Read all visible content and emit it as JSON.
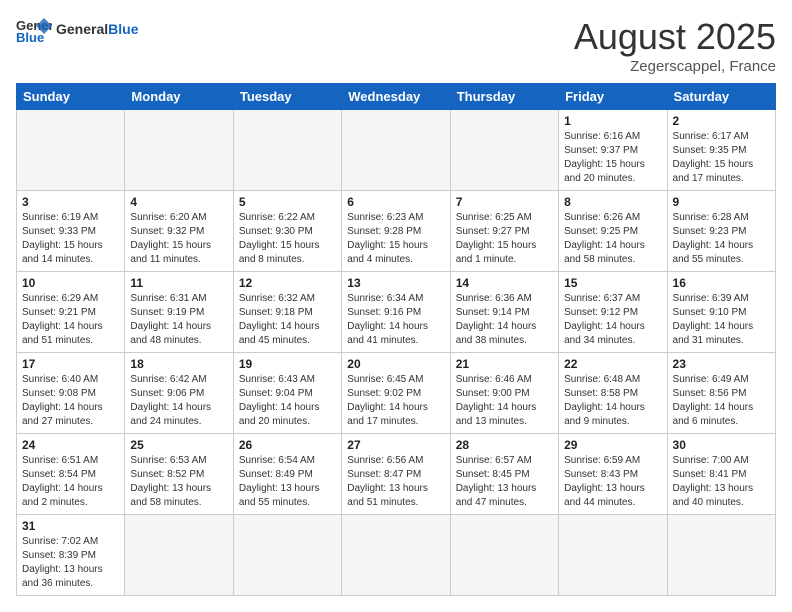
{
  "header": {
    "logo_general": "General",
    "logo_blue": "Blue",
    "month_year": "August 2025",
    "location": "Zegerscappel, France"
  },
  "weekdays": [
    "Sunday",
    "Monday",
    "Tuesday",
    "Wednesday",
    "Thursday",
    "Friday",
    "Saturday"
  ],
  "weeks": [
    [
      {
        "day": "",
        "info": ""
      },
      {
        "day": "",
        "info": ""
      },
      {
        "day": "",
        "info": ""
      },
      {
        "day": "",
        "info": ""
      },
      {
        "day": "",
        "info": ""
      },
      {
        "day": "1",
        "info": "Sunrise: 6:16 AM\nSunset: 9:37 PM\nDaylight: 15 hours\nand 20 minutes."
      },
      {
        "day": "2",
        "info": "Sunrise: 6:17 AM\nSunset: 9:35 PM\nDaylight: 15 hours\nand 17 minutes."
      }
    ],
    [
      {
        "day": "3",
        "info": "Sunrise: 6:19 AM\nSunset: 9:33 PM\nDaylight: 15 hours\nand 14 minutes."
      },
      {
        "day": "4",
        "info": "Sunrise: 6:20 AM\nSunset: 9:32 PM\nDaylight: 15 hours\nand 11 minutes."
      },
      {
        "day": "5",
        "info": "Sunrise: 6:22 AM\nSunset: 9:30 PM\nDaylight: 15 hours\nand 8 minutes."
      },
      {
        "day": "6",
        "info": "Sunrise: 6:23 AM\nSunset: 9:28 PM\nDaylight: 15 hours\nand 4 minutes."
      },
      {
        "day": "7",
        "info": "Sunrise: 6:25 AM\nSunset: 9:27 PM\nDaylight: 15 hours\nand 1 minute."
      },
      {
        "day": "8",
        "info": "Sunrise: 6:26 AM\nSunset: 9:25 PM\nDaylight: 14 hours\nand 58 minutes."
      },
      {
        "day": "9",
        "info": "Sunrise: 6:28 AM\nSunset: 9:23 PM\nDaylight: 14 hours\nand 55 minutes."
      }
    ],
    [
      {
        "day": "10",
        "info": "Sunrise: 6:29 AM\nSunset: 9:21 PM\nDaylight: 14 hours\nand 51 minutes."
      },
      {
        "day": "11",
        "info": "Sunrise: 6:31 AM\nSunset: 9:19 PM\nDaylight: 14 hours\nand 48 minutes."
      },
      {
        "day": "12",
        "info": "Sunrise: 6:32 AM\nSunset: 9:18 PM\nDaylight: 14 hours\nand 45 minutes."
      },
      {
        "day": "13",
        "info": "Sunrise: 6:34 AM\nSunset: 9:16 PM\nDaylight: 14 hours\nand 41 minutes."
      },
      {
        "day": "14",
        "info": "Sunrise: 6:36 AM\nSunset: 9:14 PM\nDaylight: 14 hours\nand 38 minutes."
      },
      {
        "day": "15",
        "info": "Sunrise: 6:37 AM\nSunset: 9:12 PM\nDaylight: 14 hours\nand 34 minutes."
      },
      {
        "day": "16",
        "info": "Sunrise: 6:39 AM\nSunset: 9:10 PM\nDaylight: 14 hours\nand 31 minutes."
      }
    ],
    [
      {
        "day": "17",
        "info": "Sunrise: 6:40 AM\nSunset: 9:08 PM\nDaylight: 14 hours\nand 27 minutes."
      },
      {
        "day": "18",
        "info": "Sunrise: 6:42 AM\nSunset: 9:06 PM\nDaylight: 14 hours\nand 24 minutes."
      },
      {
        "day": "19",
        "info": "Sunrise: 6:43 AM\nSunset: 9:04 PM\nDaylight: 14 hours\nand 20 minutes."
      },
      {
        "day": "20",
        "info": "Sunrise: 6:45 AM\nSunset: 9:02 PM\nDaylight: 14 hours\nand 17 minutes."
      },
      {
        "day": "21",
        "info": "Sunrise: 6:46 AM\nSunset: 9:00 PM\nDaylight: 14 hours\nand 13 minutes."
      },
      {
        "day": "22",
        "info": "Sunrise: 6:48 AM\nSunset: 8:58 PM\nDaylight: 14 hours\nand 9 minutes."
      },
      {
        "day": "23",
        "info": "Sunrise: 6:49 AM\nSunset: 8:56 PM\nDaylight: 14 hours\nand 6 minutes."
      }
    ],
    [
      {
        "day": "24",
        "info": "Sunrise: 6:51 AM\nSunset: 8:54 PM\nDaylight: 14 hours\nand 2 minutes."
      },
      {
        "day": "25",
        "info": "Sunrise: 6:53 AM\nSunset: 8:52 PM\nDaylight: 13 hours\nand 58 minutes."
      },
      {
        "day": "26",
        "info": "Sunrise: 6:54 AM\nSunset: 8:49 PM\nDaylight: 13 hours\nand 55 minutes."
      },
      {
        "day": "27",
        "info": "Sunrise: 6:56 AM\nSunset: 8:47 PM\nDaylight: 13 hours\nand 51 minutes."
      },
      {
        "day": "28",
        "info": "Sunrise: 6:57 AM\nSunset: 8:45 PM\nDaylight: 13 hours\nand 47 minutes."
      },
      {
        "day": "29",
        "info": "Sunrise: 6:59 AM\nSunset: 8:43 PM\nDaylight: 13 hours\nand 44 minutes."
      },
      {
        "day": "30",
        "info": "Sunrise: 7:00 AM\nSunset: 8:41 PM\nDaylight: 13 hours\nand 40 minutes."
      }
    ],
    [
      {
        "day": "31",
        "info": "Sunrise: 7:02 AM\nSunset: 8:39 PM\nDaylight: 13 hours\nand 36 minutes."
      },
      {
        "day": "",
        "info": ""
      },
      {
        "day": "",
        "info": ""
      },
      {
        "day": "",
        "info": ""
      },
      {
        "day": "",
        "info": ""
      },
      {
        "day": "",
        "info": ""
      },
      {
        "day": "",
        "info": ""
      }
    ]
  ]
}
